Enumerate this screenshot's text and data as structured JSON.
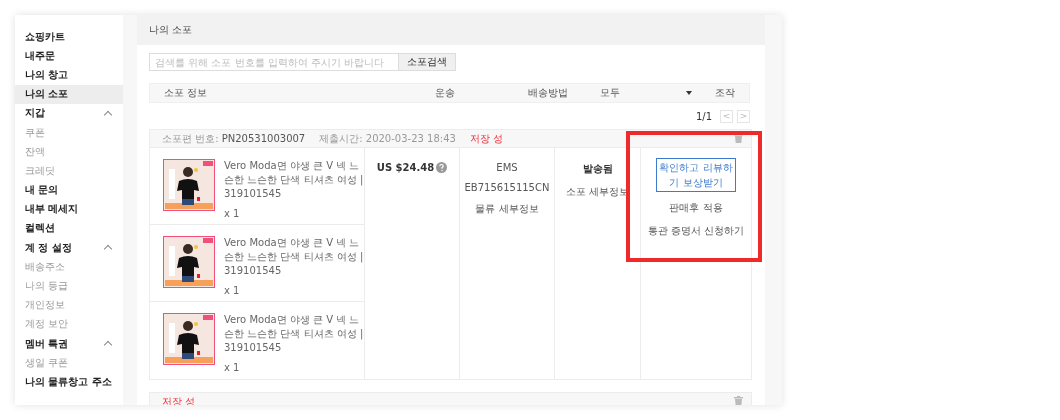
{
  "sidebar": {
    "items": [
      {
        "label": "쇼핑카트",
        "selected": false
      },
      {
        "label": "내주문",
        "selected": false
      },
      {
        "label": "나의 창고",
        "selected": false
      },
      {
        "label": "나의 소포",
        "selected": true
      },
      {
        "label": "지갑",
        "expanded": true,
        "selected": false,
        "children": [
          {
            "label": "쿠폰",
            "selected": false
          },
          {
            "label": "잔액",
            "selected": false
          },
          {
            "label": "크레딧",
            "selected": false
          }
        ]
      },
      {
        "label": "내 문의",
        "selected": false
      },
      {
        "label": "내부 메세지",
        "selected": false
      },
      {
        "label": "컬렉션",
        "selected": false
      },
      {
        "label": "계 정 설정",
        "expanded": true,
        "selected": false,
        "children": [
          {
            "label": "배송주소",
            "selected": false
          },
          {
            "label": "나의 등급",
            "selected": false
          },
          {
            "label": "개인정보",
            "selected": false
          },
          {
            "label": "계정 보안",
            "selected": false
          }
        ]
      },
      {
        "label": "멤버 특권",
        "expanded": true,
        "selected": false,
        "children": [
          {
            "label": "생일 쿠폰",
            "selected": false
          }
        ]
      },
      {
        "label": "나의 물류창고 주소",
        "selected": false
      }
    ]
  },
  "main": {
    "title": "나의 소포",
    "search": {
      "placeholder": "검색를 위해 소포 번호를 입력하여 주시기 바랍니다",
      "button": "소포검색"
    },
    "columns": [
      {
        "label": "소포 정보",
        "kind": "text"
      },
      {
        "label": "운송",
        "kind": "text"
      },
      {
        "label": "배송방법",
        "kind": "text"
      },
      {
        "label": "모두",
        "kind": "dropdown"
      },
      {
        "label": "조작",
        "kind": "text"
      }
    ],
    "pagination": {
      "page": "1/1",
      "prev": "<",
      "next": ">"
    },
    "parcels": [
      {
        "number_label": "소포편 번호:",
        "number": "PN20531003007",
        "time_label": "제출시간:",
        "time": "2020-03-23 18:43",
        "status": "저장 성",
        "items": [
          {
            "title": "Vero Moda면 야생 큰 V 넥 느슨한 느슨한 단색 티셔츠 여성 | 319101545",
            "qty": "x 1"
          },
          {
            "title": "Vero Moda면 야생 큰 V 넥 느슨한 느슨한 단색 티셔츠 여성 | 319101545",
            "qty": "x 1"
          },
          {
            "title": "Vero Moda면 야생 큰 V 넥 느슨한 느슨한 단색 티셔츠 여성 | 319101545",
            "qty": "x 1"
          }
        ],
        "price": "US $24.48",
        "shipping": {
          "method": "EMS",
          "tracking": "EB715615115CN",
          "link": "물류 세부정보"
        },
        "state": "발송됨",
        "state_link": "소포 세부정보",
        "actions": [
          {
            "label": "확인하고 리뷰하기 보상받기",
            "kind": "link"
          },
          {
            "label": "판매후 적용",
            "kind": "text"
          },
          {
            "label": "통관 증명서 신청하기",
            "kind": "text"
          }
        ]
      },
      {
        "status": "저장 성"
      }
    ]
  }
}
